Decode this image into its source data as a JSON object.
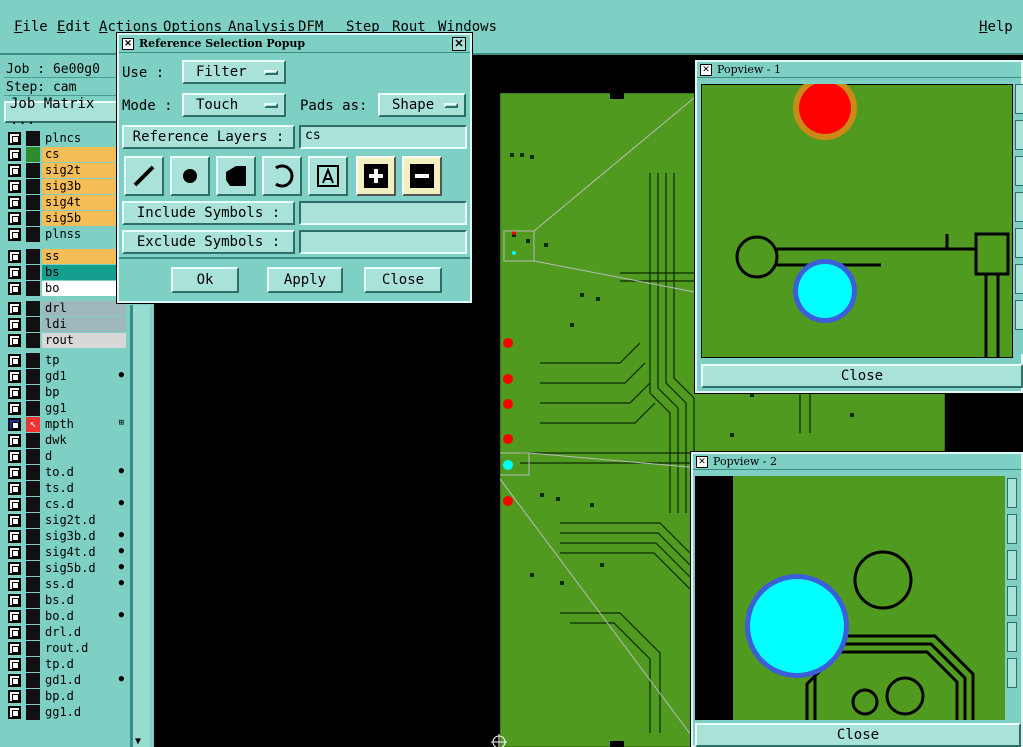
{
  "menu": {
    "items": [
      "File",
      "Edit",
      "Actions",
      "Options",
      "Analysis",
      "DFM",
      "Step",
      "Rout",
      "Windows"
    ],
    "help": "Help"
  },
  "job": {
    "job_line": "Job : 6e00g0",
    "step_line": "Step: cam",
    "matrix_label": "Job Matrix ..."
  },
  "layers": [
    {
      "name": "plncs",
      "color": "#7ed0c4",
      "swatch": "#111",
      "icon": ""
    },
    {
      "name": "cs",
      "color": "#f5bd55",
      "swatch": "#2e8b2e",
      "icon": ""
    },
    {
      "name": "sig2t",
      "color": "#f5bd55",
      "swatch": "#111",
      "icon": ""
    },
    {
      "name": "sig3b",
      "color": "#f5bd55",
      "swatch": "#111",
      "icon": ""
    },
    {
      "name": "sig4t",
      "color": "#f5bd55",
      "swatch": "#111",
      "icon": ""
    },
    {
      "name": "sig5b",
      "color": "#f5bd55",
      "swatch": "#111",
      "icon": ""
    },
    {
      "name": "plnss",
      "color": "#7ed0c4",
      "swatch": "#111",
      "icon": ""
    },
    {
      "name": "ss",
      "color": "#f5bd55",
      "swatch": "#111",
      "icon": ""
    },
    {
      "name": "bs",
      "color": "#159f8e",
      "swatch": "#111",
      "icon": ""
    },
    {
      "name": "bo",
      "color": "#ffffff",
      "swatch": "#111",
      "icon": ""
    },
    {
      "name": "drl",
      "color": "#9fb8bc",
      "swatch": "#111",
      "icon": ""
    },
    {
      "name": "ldi",
      "color": "#9fb8bc",
      "swatch": "#111",
      "icon": ""
    },
    {
      "name": "rout",
      "color": "#d8d8d8",
      "swatch": "#111",
      "icon": ""
    },
    {
      "name": "tp",
      "color": "#7ed0c4",
      "swatch": "#111",
      "icon": ""
    },
    {
      "name": "gd1",
      "color": "#7ed0c4",
      "swatch": "#111",
      "icon": "●"
    },
    {
      "name": "bp",
      "color": "#7ed0c4",
      "swatch": "#111",
      "icon": ""
    },
    {
      "name": "gg1",
      "color": "#7ed0c4",
      "swatch": "#111",
      "icon": ""
    },
    {
      "name": "mpth",
      "color": "#7ed0c4",
      "swatch": "#111",
      "icon": "⊞"
    },
    {
      "name": "dwk",
      "color": "#7ed0c4",
      "swatch": "#111",
      "icon": ""
    },
    {
      "name": "d",
      "color": "#7ed0c4",
      "swatch": "#111",
      "icon": ""
    },
    {
      "name": "to.d",
      "color": "#7ed0c4",
      "swatch": "#111",
      "icon": "●"
    },
    {
      "name": "ts.d",
      "color": "#7ed0c4",
      "swatch": "#111",
      "icon": ""
    },
    {
      "name": "cs.d",
      "color": "#7ed0c4",
      "swatch": "#111",
      "icon": "●"
    },
    {
      "name": "sig2t.d",
      "color": "#7ed0c4",
      "swatch": "#111",
      "icon": ""
    },
    {
      "name": "sig3b.d",
      "color": "#7ed0c4",
      "swatch": "#111",
      "icon": "●"
    },
    {
      "name": "sig4t.d",
      "color": "#7ed0c4",
      "swatch": "#111",
      "icon": "●"
    },
    {
      "name": "sig5b.d",
      "color": "#7ed0c4",
      "swatch": "#111",
      "icon": "●"
    },
    {
      "name": "ss.d",
      "color": "#7ed0c4",
      "swatch": "#111",
      "icon": "●"
    },
    {
      "name": "bs.d",
      "color": "#7ed0c4",
      "swatch": "#111",
      "icon": ""
    },
    {
      "name": "bo.d",
      "color": "#7ed0c4",
      "swatch": "#111",
      "icon": "●"
    },
    {
      "name": "drl.d",
      "color": "#7ed0c4",
      "swatch": "#111",
      "icon": ""
    },
    {
      "name": "rout.d",
      "color": "#7ed0c4",
      "swatch": "#111",
      "icon": ""
    },
    {
      "name": "tp.d",
      "color": "#7ed0c4",
      "swatch": "#111",
      "icon": ""
    },
    {
      "name": "gd1.d",
      "color": "#7ed0c4",
      "swatch": "#111",
      "icon": "●"
    },
    {
      "name": "bp.d",
      "color": "#7ed0c4",
      "swatch": "#111",
      "icon": ""
    },
    {
      "name": "gg1.d",
      "color": "#7ed0c4",
      "swatch": "#111",
      "icon": ""
    }
  ],
  "popup": {
    "title": "Reference Selection Popup",
    "use_label": "Use  :",
    "use_value": "Filter",
    "mode_label": "Mode  :",
    "mode_value": "Touch",
    "pads_label": "Pads as:",
    "pads_value": "Shape",
    "ref_layers_label": "Reference Layers :",
    "ref_layers_value": "cs",
    "include_label": "Include Symbols :",
    "include_value": "",
    "exclude_label": "Exclude Symbols :",
    "exclude_value": "",
    "ok": "Ok",
    "apply": "Apply",
    "close": "Close"
  },
  "popview1": {
    "title": "Popview - 1",
    "close": "Close"
  },
  "popview2": {
    "title": "Popview - 2",
    "close": "Close"
  },
  "colors": {
    "panel": "#7ed0c4",
    "board": "#4f9a1f",
    "trace": "#000000",
    "pad_red": "#ff0000",
    "pad_cyan": "#00ffff"
  }
}
